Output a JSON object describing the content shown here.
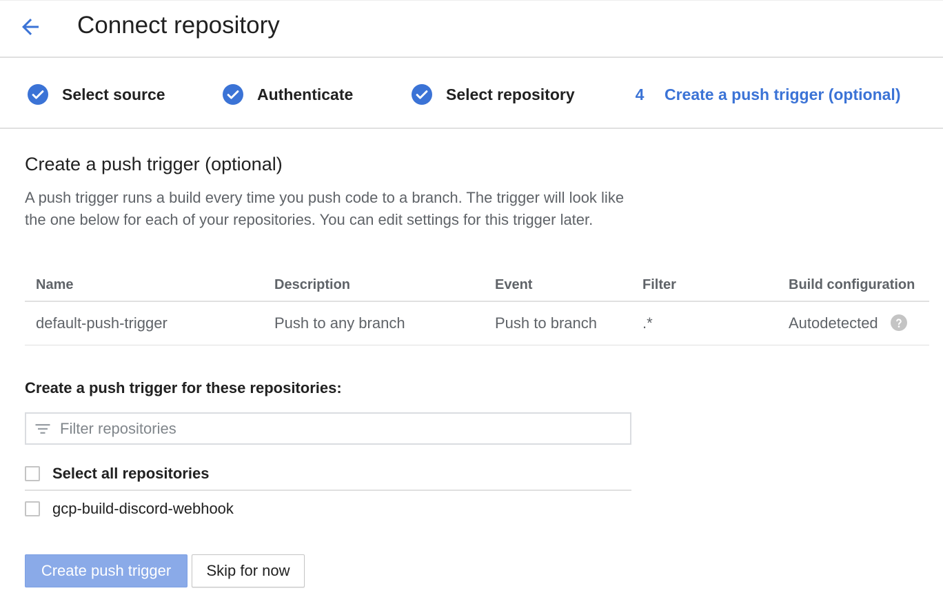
{
  "header": {
    "title": "Connect repository",
    "back_icon": "arrow-back-icon"
  },
  "stepper": {
    "steps": [
      {
        "label": "Select source",
        "status": "complete",
        "icon": "check-circle-icon"
      },
      {
        "label": "Authenticate",
        "status": "complete",
        "icon": "check-circle-icon"
      },
      {
        "label": "Select repository",
        "status": "complete",
        "icon": "check-circle-icon"
      },
      {
        "number": "4",
        "label": "Create a push trigger (optional)",
        "status": "active"
      }
    ]
  },
  "section": {
    "title": "Create a push trigger (optional)",
    "description": "A push trigger runs a build every time you push code to a branch. The trigger will look like the one below for each of your repositories. You can edit settings for this trigger later."
  },
  "trigger_table": {
    "columns": [
      "Name",
      "Description",
      "Event",
      "Filter",
      "Build configuration"
    ],
    "rows": [
      {
        "name": "default-push-trigger",
        "description": "Push to any branch",
        "event": "Push to branch",
        "filter": ".*",
        "build_configuration": "Autodetected",
        "help_icon": "help-circle-icon"
      }
    ]
  },
  "repositories": {
    "heading": "Create a push trigger for these repositories:",
    "filter_placeholder": "Filter repositories",
    "filter_value": "",
    "filter_icon": "filter-list-icon",
    "select_all_label": "Select all repositories",
    "select_all_checked": false,
    "items": [
      {
        "label": "gcp-build-discord-webhook",
        "checked": false
      }
    ]
  },
  "actions": {
    "primary_label": "Create push trigger",
    "primary_disabled": true,
    "secondary_label": "Skip for now"
  },
  "colors": {
    "accent": "#3b73d6",
    "primary_button_disabled": "#8aaae8",
    "text": "#212121",
    "secondary_text": "#5f6368",
    "divider": "#e0e0e0"
  }
}
